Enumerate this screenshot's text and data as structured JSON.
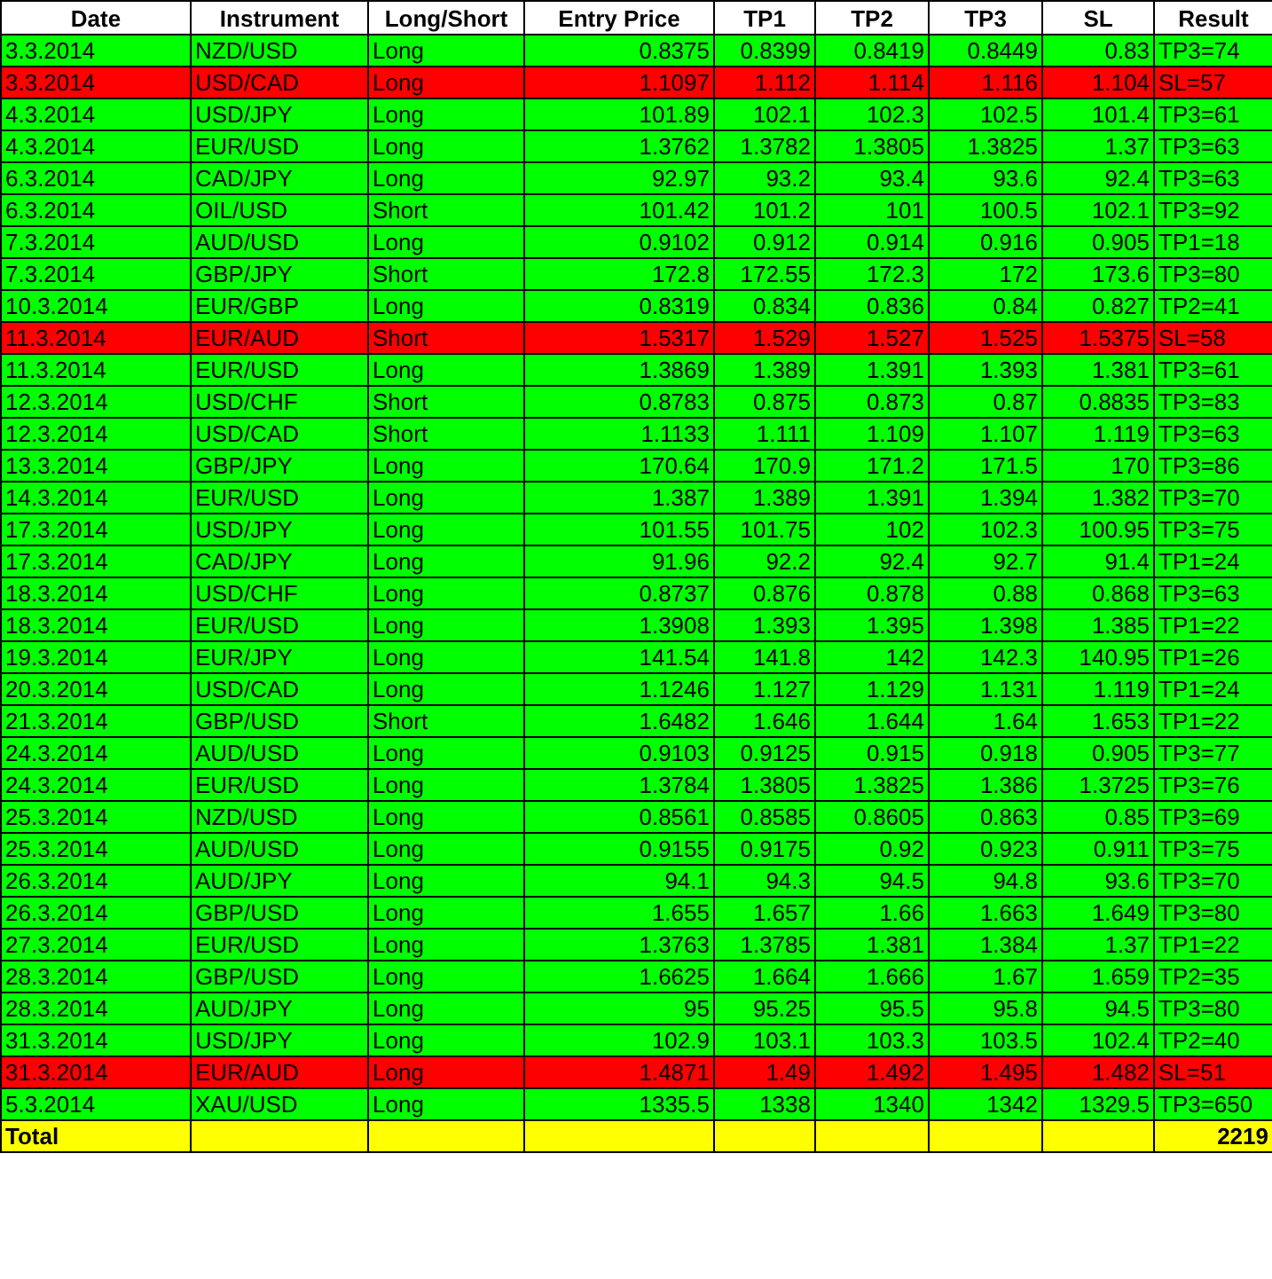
{
  "table": {
    "columns": [
      "Date",
      "Instrument",
      "Long/Short",
      "Entry Price",
      "TP1",
      "TP2",
      "TP3",
      "SL",
      "Result"
    ],
    "rows": [
      {
        "cells": [
          "3.3.2014",
          "NZD/USD",
          "Long",
          "0.8375",
          "0.8399",
          "0.8419",
          "0.8449",
          "0.83",
          "TP3=74"
        ],
        "stopped": false
      },
      {
        "cells": [
          "3.3.2014",
          "USD/CAD",
          "Long",
          "1.1097",
          "1.112",
          "1.114",
          "1.116",
          "1.104",
          "SL=57"
        ],
        "stopped": true
      },
      {
        "cells": [
          "4.3.2014",
          "USD/JPY",
          "Long",
          "101.89",
          "102.1",
          "102.3",
          "102.5",
          "101.4",
          "TP3=61"
        ],
        "stopped": false
      },
      {
        "cells": [
          "4.3.2014",
          "EUR/USD",
          "Long",
          "1.3762",
          "1.3782",
          "1.3805",
          "1.3825",
          "1.37",
          "TP3=63"
        ],
        "stopped": false
      },
      {
        "cells": [
          "6.3.2014",
          "CAD/JPY",
          "Long",
          "92.97",
          "93.2",
          "93.4",
          "93.6",
          "92.4",
          "TP3=63"
        ],
        "stopped": false
      },
      {
        "cells": [
          "6.3.2014",
          "OIL/USD",
          "Short",
          "101.42",
          "101.2",
          "101",
          "100.5",
          "102.1",
          "TP3=92"
        ],
        "stopped": false
      },
      {
        "cells": [
          "7.3.2014",
          "AUD/USD",
          "Long",
          "0.9102",
          "0.912",
          "0.914",
          "0.916",
          "0.905",
          "TP1=18"
        ],
        "stopped": false
      },
      {
        "cells": [
          "7.3.2014",
          "GBP/JPY",
          "Short",
          "172.8",
          "172.55",
          "172.3",
          "172",
          "173.6",
          "TP3=80"
        ],
        "stopped": false
      },
      {
        "cells": [
          "10.3.2014",
          "EUR/GBP",
          "Long",
          "0.8319",
          "0.834",
          "0.836",
          "0.84",
          "0.827",
          "TP2=41"
        ],
        "stopped": false
      },
      {
        "cells": [
          "11.3.2014",
          "EUR/AUD",
          "Short",
          "1.5317",
          "1.529",
          "1.527",
          "1.525",
          "1.5375",
          "SL=58"
        ],
        "stopped": true
      },
      {
        "cells": [
          "11.3.2014",
          "EUR/USD",
          "Long",
          "1.3869",
          "1.389",
          "1.391",
          "1.393",
          "1.381",
          "TP3=61"
        ],
        "stopped": false
      },
      {
        "cells": [
          "12.3.2014",
          "USD/CHF",
          "Short",
          "0.8783",
          "0.875",
          "0.873",
          "0.87",
          "0.8835",
          "TP3=83"
        ],
        "stopped": false
      },
      {
        "cells": [
          "12.3.2014",
          "USD/CAD",
          "Short",
          "1.1133",
          "1.111",
          "1.109",
          "1.107",
          "1.119",
          "TP3=63"
        ],
        "stopped": false
      },
      {
        "cells": [
          "13.3.2014",
          "GBP/JPY",
          "Long",
          "170.64",
          "170.9",
          "171.2",
          "171.5",
          "170",
          "TP3=86"
        ],
        "stopped": false
      },
      {
        "cells": [
          "14.3.2014",
          "EUR/USD",
          "Long",
          "1.387",
          "1.389",
          "1.391",
          "1.394",
          "1.382",
          "TP3=70"
        ],
        "stopped": false
      },
      {
        "cells": [
          "17.3.2014",
          "USD/JPY",
          "Long",
          "101.55",
          "101.75",
          "102",
          "102.3",
          "100.95",
          "TP3=75"
        ],
        "stopped": false
      },
      {
        "cells": [
          "17.3.2014",
          "CAD/JPY",
          "Long",
          "91.96",
          "92.2",
          "92.4",
          "92.7",
          "91.4",
          "TP1=24"
        ],
        "stopped": false
      },
      {
        "cells": [
          "18.3.2014",
          "USD/CHF",
          "Long",
          "0.8737",
          "0.876",
          "0.878",
          "0.88",
          "0.868",
          "TP3=63"
        ],
        "stopped": false
      },
      {
        "cells": [
          "18.3.2014",
          "EUR/USD",
          "Long",
          "1.3908",
          "1.393",
          "1.395",
          "1.398",
          "1.385",
          "TP1=22"
        ],
        "stopped": false
      },
      {
        "cells": [
          "19.3.2014",
          "EUR/JPY",
          "Long",
          "141.54",
          "141.8",
          "142",
          "142.3",
          "140.95",
          "TP1=26"
        ],
        "stopped": false
      },
      {
        "cells": [
          "20.3.2014",
          "USD/CAD",
          "Long",
          "1.1246",
          "1.127",
          "1.129",
          "1.131",
          "1.119",
          "TP1=24"
        ],
        "stopped": false
      },
      {
        "cells": [
          "21.3.2014",
          "GBP/USD",
          "Short",
          "1.6482",
          "1.646",
          "1.644",
          "1.64",
          "1.653",
          "TP1=22"
        ],
        "stopped": false
      },
      {
        "cells": [
          "24.3.2014",
          "AUD/USD",
          "Long",
          "0.9103",
          "0.9125",
          "0.915",
          "0.918",
          "0.905",
          "TP3=77"
        ],
        "stopped": false
      },
      {
        "cells": [
          "24.3.2014",
          "EUR/USD",
          "Long",
          "1.3784",
          "1.3805",
          "1.3825",
          "1.386",
          "1.3725",
          "TP3=76"
        ],
        "stopped": false
      },
      {
        "cells": [
          "25.3.2014",
          "NZD/USD",
          "Long",
          "0.8561",
          "0.8585",
          "0.8605",
          "0.863",
          "0.85",
          "TP3=69"
        ],
        "stopped": false
      },
      {
        "cells": [
          "25.3.2014",
          "AUD/USD",
          "Long",
          "0.9155",
          "0.9175",
          "0.92",
          "0.923",
          "0.911",
          "TP3=75"
        ],
        "stopped": false
      },
      {
        "cells": [
          "26.3.2014",
          "AUD/JPY",
          "Long",
          "94.1",
          "94.3",
          "94.5",
          "94.8",
          "93.6",
          "TP3=70"
        ],
        "stopped": false
      },
      {
        "cells": [
          "26.3.2014",
          "GBP/USD",
          "Long",
          "1.655",
          "1.657",
          "1.66",
          "1.663",
          "1.649",
          "TP3=80"
        ],
        "stopped": false
      },
      {
        "cells": [
          "27.3.2014",
          "EUR/USD",
          "Long",
          "1.3763",
          "1.3785",
          "1.381",
          "1.384",
          "1.37",
          "TP1=22"
        ],
        "stopped": false
      },
      {
        "cells": [
          "28.3.2014",
          "GBP/USD",
          "Long",
          "1.6625",
          "1.664",
          "1.666",
          "1.67",
          "1.659",
          "TP2=35"
        ],
        "stopped": false
      },
      {
        "cells": [
          "28.3.2014",
          "AUD/JPY",
          "Long",
          "95",
          "95.25",
          "95.5",
          "95.8",
          "94.5",
          "TP3=80"
        ],
        "stopped": false
      },
      {
        "cells": [
          "31.3.2014",
          "USD/JPY",
          "Long",
          "102.9",
          "103.1",
          "103.3",
          "103.5",
          "102.4",
          "TP2=40"
        ],
        "stopped": false
      },
      {
        "cells": [
          "31.3.2014",
          "EUR/AUD",
          "Long",
          "1.4871",
          "1.49",
          "1.492",
          "1.495",
          "1.482",
          "SL=51"
        ],
        "stopped": true
      },
      {
        "cells": [
          "5.3.2014",
          "XAU/USD",
          "Long",
          "1335.5",
          "1338",
          "1340",
          "1342",
          "1329.5",
          "TP3=650"
        ],
        "stopped": false
      }
    ],
    "total": {
      "label": "Total",
      "value": "2219"
    }
  }
}
